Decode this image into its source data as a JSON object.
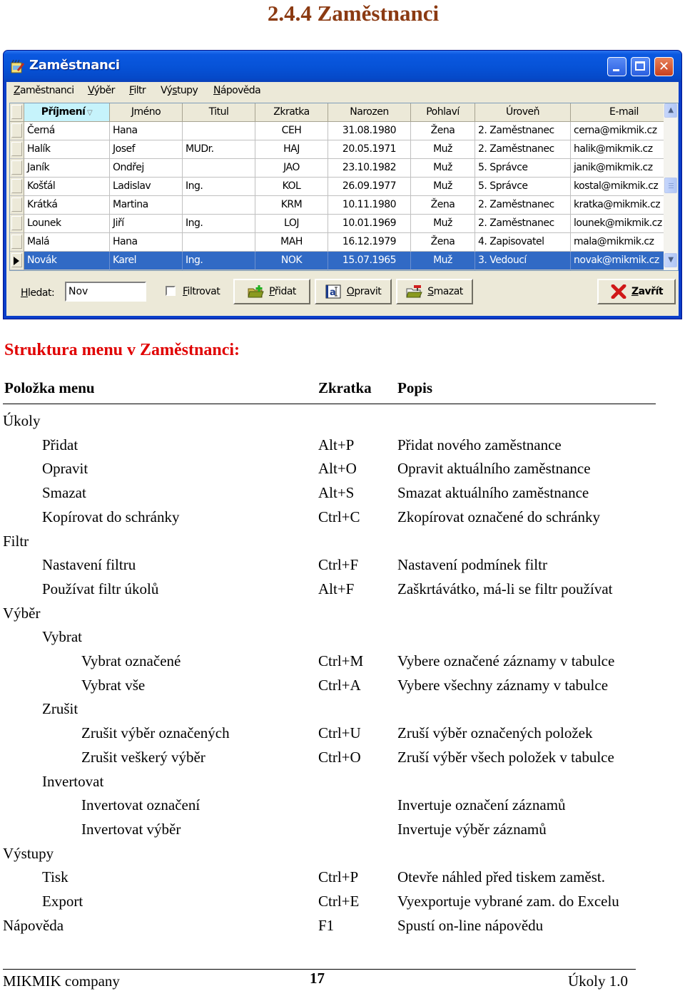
{
  "document": {
    "heading": "2.4.4 Zaměstnanci",
    "section_title": "Struktura menu v Zaměstnanci:"
  },
  "window": {
    "title": "Zaměstnanci",
    "app_icon": "notepad-pencil-icon",
    "controls": {
      "minimize": "minimize-icon",
      "maximize": "maximize-icon",
      "close": "close-icon"
    },
    "menu": [
      {
        "label": "Zaměstnanci",
        "accel": "Z"
      },
      {
        "label": "Výběr",
        "accel": "V"
      },
      {
        "label": "Filtr",
        "accel": "F"
      },
      {
        "label": "Výstupy",
        "accel": "s"
      },
      {
        "label": "Nápověda",
        "accel": "N"
      }
    ],
    "grid": {
      "columns": [
        "Příjmení",
        "Jméno",
        "Titul",
        "Zkratka",
        "Narozen",
        "Pohlaví",
        "Úroveň",
        "E-mail"
      ],
      "sorted_column": "Příjmení",
      "sort_icon": "sort-descending-triangle-icon",
      "rows": [
        [
          "Černá",
          "Hana",
          "",
          "CEH",
          "31.08.1980",
          "Žena",
          "2. Zaměstnanec",
          "cerna@mikmik.cz"
        ],
        [
          "Halík",
          "Josef",
          "MUDr.",
          "HAJ",
          "20.05.1971",
          "Muž",
          "2. Zaměstnanec",
          "halik@mikmik.cz"
        ],
        [
          "Janík",
          "Ondřej",
          "",
          "JAO",
          "23.10.1982",
          "Muž",
          "5. Správce",
          "janik@mikmik.cz"
        ],
        [
          "Košťál",
          "Ladislav",
          "Ing.",
          "KOL",
          "26.09.1977",
          "Muž",
          "5. Správce",
          "kostal@mikmik.cz"
        ],
        [
          "Krátká",
          "Martina",
          "",
          "KRM",
          "10.11.1980",
          "Žena",
          "2. Zaměstnanec",
          "kratka@mikmik.cz"
        ],
        [
          "Lounek",
          "Jiří",
          "Ing.",
          "LOJ",
          "10.01.1969",
          "Muž",
          "2. Zaměstnanec",
          "lounek@mikmik.cz"
        ],
        [
          "Malá",
          "Hana",
          "",
          "MAH",
          "16.12.1979",
          "Žena",
          "4. Zapisovatel",
          "mala@mikmik.cz"
        ],
        [
          "Novák",
          "Karel",
          "Ing.",
          "NOK",
          "15.07.1965",
          "Muž",
          "3. Vedoucí",
          "novak@mikmik.cz"
        ]
      ],
      "selected_row": 7,
      "selection_color": "#316ac5"
    },
    "toolbar": {
      "search_label": "Hledat:",
      "search_accel": "H",
      "search_value": "Nov",
      "filter_label": "Filtrovat",
      "filter_accel": "F",
      "filter_checked": false,
      "add_label": "Přidat",
      "add_accel": "P",
      "edit_label": "Opravit",
      "edit_accel": "O",
      "delete_label": "Smazat",
      "delete_accel": "S",
      "close_label": "Zavřít",
      "close_accel": "Z"
    }
  },
  "menu_table": {
    "headers": {
      "item": "Položka menu",
      "shortcut": "Zkratka",
      "description": "Popis"
    },
    "rows": [
      {
        "level": 0,
        "item": "Úkoly",
        "shortcut": "",
        "description": ""
      },
      {
        "level": 1,
        "item": "Přidat",
        "shortcut": "Alt+P",
        "description": "Přidat nového zaměstnance"
      },
      {
        "level": 1,
        "item": "Opravit",
        "shortcut": "Alt+O",
        "description": "Opravit aktuálního zaměstnance"
      },
      {
        "level": 1,
        "item": "Smazat",
        "shortcut": "Alt+S",
        "description": "Smazat aktuálního zaměstnance"
      },
      {
        "level": 1,
        "item": "Kopírovat do schránky",
        "shortcut": "Ctrl+C",
        "description": "Zkopírovat označené do schránky"
      },
      {
        "level": 0,
        "item": "Filtr",
        "shortcut": "",
        "description": ""
      },
      {
        "level": 1,
        "item": "Nastavení filtru",
        "shortcut": "Ctrl+F",
        "description": "Nastavení podmínek filtr"
      },
      {
        "level": 1,
        "item": "Používat filtr úkolů",
        "shortcut": "Alt+F",
        "description": "Zaškrtávátko, má-li se filtr používat"
      },
      {
        "level": 0,
        "item": "Výběr",
        "shortcut": "",
        "description": ""
      },
      {
        "level": 1,
        "item": "Vybrat",
        "shortcut": "",
        "description": ""
      },
      {
        "level": 2,
        "item": "Vybrat označené",
        "shortcut": "Ctrl+M",
        "description": "Vybere označené záznamy v tabulce"
      },
      {
        "level": 2,
        "item": "Vybrat vše",
        "shortcut": "Ctrl+A",
        "description": "Vybere všechny záznamy v tabulce"
      },
      {
        "level": 1,
        "item": "Zrušit",
        "shortcut": "",
        "description": ""
      },
      {
        "level": 2,
        "item": "Zrušit výběr označených",
        "shortcut": "Ctrl+U",
        "description": "Zruší výběr označených položek"
      },
      {
        "level": 2,
        "item": "Zrušit veškerý výběr",
        "shortcut": "Ctrl+O",
        "description": "Zruší výběr všech položek v tabulce"
      },
      {
        "level": 1,
        "item": "Invertovat",
        "shortcut": "",
        "description": ""
      },
      {
        "level": 2,
        "item": "Invertovat označení",
        "shortcut": "",
        "description": "Invertuje označení záznamů"
      },
      {
        "level": 2,
        "item": "Invertovat výběr",
        "shortcut": "",
        "description": "Invertuje výběr záznamů"
      },
      {
        "level": 0,
        "item": "Výstupy",
        "shortcut": "",
        "description": ""
      },
      {
        "level": 1,
        "item": "Tisk",
        "shortcut": "Ctrl+P",
        "description": "Otevře náhled před tiskem zaměst."
      },
      {
        "level": 1,
        "item": "Export",
        "shortcut": "Ctrl+E",
        "description": "Vyexportuje vybrané zam. do Excelu"
      },
      {
        "level": 0,
        "item": "Nápověda",
        "shortcut": "F1",
        "description": "Spustí on-line nápovědu"
      }
    ]
  },
  "footer": {
    "company": "MIKMIK company",
    "page_number": "17",
    "product": "Úkoly 1.0"
  },
  "colors": {
    "heading": "#8b3a12",
    "section_title": "#e00000",
    "titlebar": "#0753d8",
    "selection": "#316ac5",
    "sorted_header": "#c6f3fb"
  }
}
